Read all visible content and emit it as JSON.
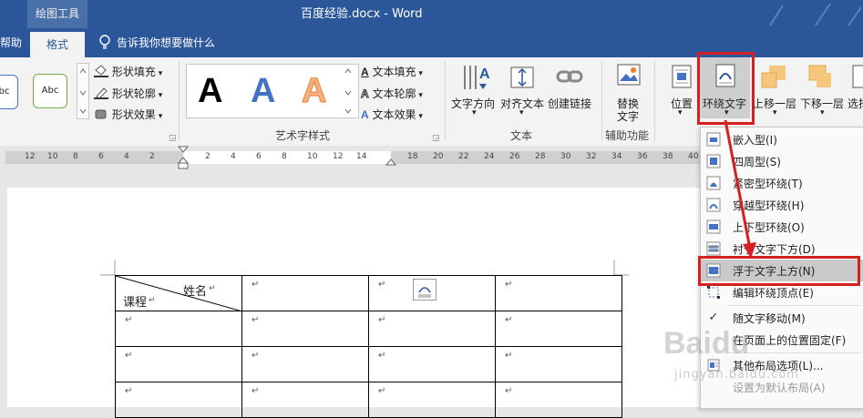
{
  "titlebar": {
    "contextual_tab": "绘图工具",
    "title": "百度经验.docx  -  Word"
  },
  "tabs": {
    "help": "帮助",
    "format": "格式",
    "tell_me": "告诉我你想要做什么"
  },
  "ribbon": {
    "shape_styles": {
      "thumb1": "Abc",
      "thumb2": "Abc",
      "fill": "形状填充",
      "outline": "形状轮廓",
      "effects": "形状效果"
    },
    "wordart": {
      "letters": [
        "A",
        "A",
        "A"
      ],
      "fill": "文本填充",
      "outline": "文本轮廓",
      "effects": "文本效果",
      "group_label": "艺术字样式"
    },
    "text": {
      "direction": "文字方向",
      "align": "对齐文本",
      "link": "创建链接",
      "group_label": "文本"
    },
    "accessibility": {
      "alt_line1": "替换",
      "alt_line2": "文字",
      "group_label": "辅助功能"
    },
    "arrange": {
      "position": "位置",
      "wrap": "环绕文字",
      "forward": "上移一层",
      "backward": "下移一层",
      "select": "选择"
    }
  },
  "ruler": {
    "numbers": [
      "12",
      "10",
      "8",
      "6",
      "4",
      "2",
      "2",
      "4",
      "6",
      "8",
      "10",
      "12",
      "14",
      "18",
      "20",
      "22",
      "24",
      "26",
      "28",
      "30",
      "32",
      "34",
      "36",
      "38",
      "40"
    ]
  },
  "document": {
    "header_name": "姓名",
    "header_course": "课程"
  },
  "wrap_menu": {
    "items": [
      {
        "label": "嵌入型(I)",
        "icon": "inline-icon",
        "disabled": false
      },
      {
        "label": "四周型(S)",
        "icon": "square-wrap-icon",
        "disabled": false
      },
      {
        "label": "紧密型环绕(T)",
        "icon": "tight-wrap-icon",
        "disabled": false
      },
      {
        "label": "穿越型环绕(H)",
        "icon": "through-wrap-icon",
        "disabled": false
      },
      {
        "label": "上下型环绕(O)",
        "icon": "top-bottom-wrap-icon",
        "disabled": false
      },
      {
        "label": "衬于文字下方(D)",
        "icon": "behind-text-icon",
        "disabled": false
      },
      {
        "label": "浮于文字上方(N)",
        "icon": "in-front-of-text-icon",
        "disabled": false
      },
      {
        "label": "编辑环绕顶点(E)",
        "icon": "edit-wrap-points-icon",
        "disabled": false
      },
      {
        "label": "随文字移动(M)",
        "icon": "check-icon",
        "disabled": false
      },
      {
        "label": "在页面上的位置固定(F)",
        "icon": "",
        "disabled": false
      },
      {
        "label": "其他布局选项(L)...",
        "icon": "layout-options-icon",
        "disabled": false
      },
      {
        "label": "设置为默认布局(A)",
        "icon": "",
        "disabled": true
      }
    ]
  },
  "colors": {
    "accent": "#2b579a",
    "highlight": "#d42020"
  }
}
